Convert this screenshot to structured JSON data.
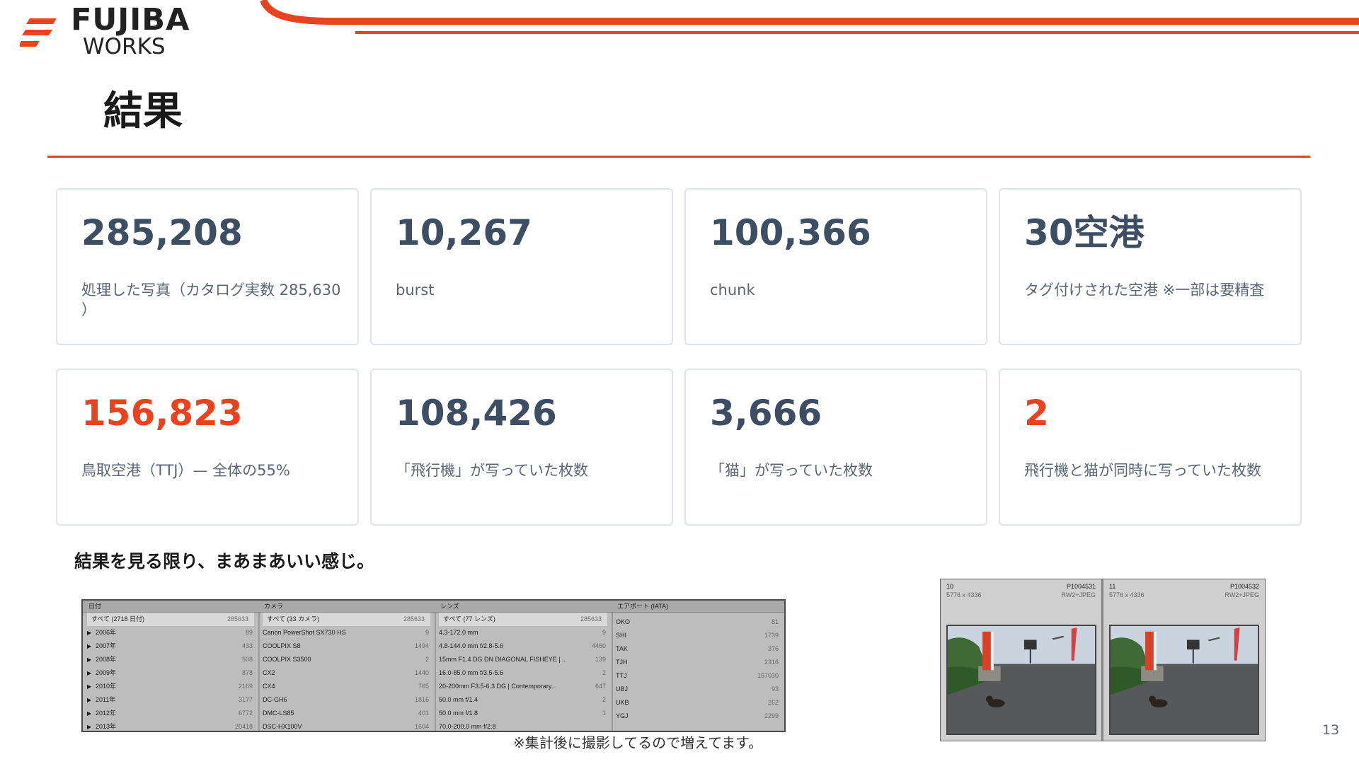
{
  "brand": {
    "line1": "FUJIBA",
    "line2": "WORKS",
    "accent": "#e8431e"
  },
  "page": {
    "title": "結果",
    "number": "13"
  },
  "stats": [
    {
      "value": "285,208",
      "label": "処理した写真（カタログ実数 285,630 ）",
      "accent": false
    },
    {
      "value": "10,267",
      "label": "burst",
      "accent": false
    },
    {
      "value": "100,366",
      "label": "chunk",
      "accent": false
    },
    {
      "value": "30空港",
      "label": "タグ付けされた空港 ※一部は要精査",
      "accent": false
    },
    {
      "value": "156,823",
      "label": "鳥取空港（TTJ）— 全体の55%",
      "accent": true
    },
    {
      "value": "108,426",
      "label": "「飛行機」が写っていた枚数",
      "accent": false
    },
    {
      "value": "3,666",
      "label": "「猫」が写っていた枚数",
      "accent": false
    },
    {
      "value": "2",
      "label": "飛行機と猫が同時に写っていた枚数",
      "accent": true
    }
  ],
  "summary": "結果を見る限り、まあまあいい感じ。",
  "note": "※集計後に撮影してるので増えてます。",
  "filter_panel": {
    "columns": [
      {
        "header": "日付",
        "rows": [
          {
            "label": "すべて (2718 日付)",
            "count": "285633",
            "selected": true,
            "expand": false
          },
          {
            "label": "2006年",
            "count": "89",
            "expand": true
          },
          {
            "label": "2007年",
            "count": "433",
            "expand": true
          },
          {
            "label": "2008年",
            "count": "508",
            "expand": true
          },
          {
            "label": "2009年",
            "count": "878",
            "expand": true
          },
          {
            "label": "2010年",
            "count": "2169",
            "expand": true
          },
          {
            "label": "2011年",
            "count": "3177",
            "expand": true
          },
          {
            "label": "2012年",
            "count": "6772",
            "expand": true
          },
          {
            "label": "2013年",
            "count": "20418",
            "expand": true
          }
        ]
      },
      {
        "header": "カメラ",
        "rows": [
          {
            "label": "すべて (33 カメラ)",
            "count": "285633",
            "selected": true
          },
          {
            "label": "Canon PowerShot SX730 HS",
            "count": "9"
          },
          {
            "label": "COOLPIX S8",
            "count": "1494"
          },
          {
            "label": "COOLPIX S3500",
            "count": "2"
          },
          {
            "label": "CX2",
            "count": "1440"
          },
          {
            "label": "CX4",
            "count": "765"
          },
          {
            "label": "DC-GH6",
            "count": "1816"
          },
          {
            "label": "DMC-LS85",
            "count": "401"
          },
          {
            "label": "DSC-HX100V",
            "count": "1604"
          }
        ]
      },
      {
        "header": "レンズ",
        "rows": [
          {
            "label": "すべて (77 レンズ)",
            "count": "285633",
            "selected": true
          },
          {
            "label": "4.3-172.0 mm",
            "count": "9"
          },
          {
            "label": "4.8-144.0 mm f/2.8-5.6",
            "count": "4460"
          },
          {
            "label": "15mm F1.4 DG DN DIAGONAL FISHEYE |...",
            "count": "139"
          },
          {
            "label": "16.0-85.0 mm f/3.5-5.6",
            "count": "2"
          },
          {
            "label": "20-200mm F3.5-6.3 DG | Contemporary...",
            "count": "647"
          },
          {
            "label": "50.0 mm f/1.4",
            "count": "2"
          },
          {
            "label": "50.0 mm f/1.8",
            "count": "1"
          },
          {
            "label": "70.0-200.0 mm f/2.8",
            "count": ""
          }
        ]
      },
      {
        "header": "エアポート (IATA)",
        "rows": [
          {
            "label": "OKO",
            "count": "81"
          },
          {
            "label": "SHI",
            "count": "1739"
          },
          {
            "label": "TAK",
            "count": "376"
          },
          {
            "label": "TJH",
            "count": "2316"
          },
          {
            "label": "TTJ",
            "count": "157030"
          },
          {
            "label": "UBJ",
            "count": "93"
          },
          {
            "label": "UKB",
            "count": "262"
          },
          {
            "label": "YGJ",
            "count": "2299"
          }
        ]
      }
    ]
  },
  "thumbnails": [
    {
      "index": "10",
      "dims": "5776 x 4336",
      "filename": "P1004531",
      "format": "RW2+JPEG"
    },
    {
      "index": "11",
      "dims": "5776 x 4336",
      "filename": "P1004532",
      "format": "RW2+JPEG"
    }
  ]
}
